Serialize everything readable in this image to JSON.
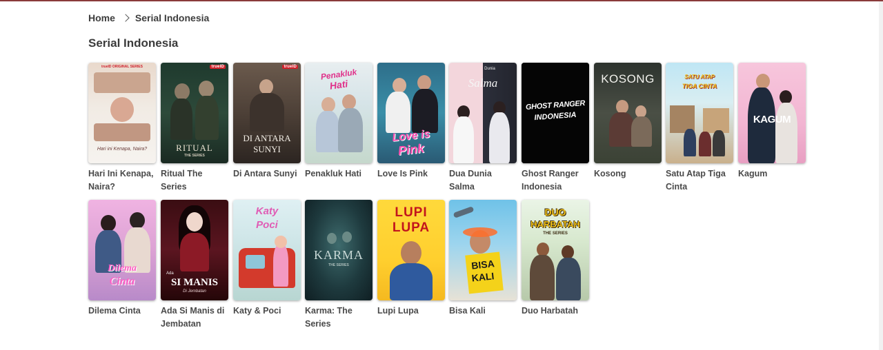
{
  "breadcrumb": {
    "home": "Home",
    "current": "Serial Indonesia"
  },
  "section": {
    "title": "Serial Indonesia"
  },
  "posters": {
    "naira": {
      "logo": "trueID",
      "tag": "trueID ORIGINAL SERIES",
      "text": "Hari ini Kenapa, Naira?"
    },
    "ritual": {
      "logo": "trueID",
      "text": "RITUAL",
      "sub": "THE SERIES"
    },
    "antara": {
      "logo": "trueID",
      "line1": "DI ANTARA",
      "line2": "SUNYI"
    },
    "penakluk": {
      "line1": "Penakluk",
      "line2": "Hati"
    },
    "love": {
      "line1": "Love is",
      "line2": "Pink"
    },
    "salma": {
      "small": "Dunia",
      "text": "Salma"
    },
    "ghost": {
      "line1": "GHOST RANGER",
      "line2": "INDONESIA"
    },
    "kosong": {
      "text": "KOSONG"
    },
    "satu": {
      "line1": "SATU ATAP",
      "line2": "TIGA CINTA"
    },
    "kagum": {
      "text": "KAGUM"
    },
    "dilema": {
      "line1": "Dilema",
      "line2": "Cinta"
    },
    "manis": {
      "small": "Ada",
      "text": "SI MANIS",
      "sub": "Di Jembatan"
    },
    "katy": {
      "line1": "Katy",
      "line2": "Poci"
    },
    "karma": {
      "text": "KARMA",
      "sub": "THE SERIES"
    },
    "lupi": {
      "line1": "LUPI",
      "line2": "LUPA"
    },
    "bisa": {
      "line1": "BISA",
      "line2": "KALI"
    },
    "duo": {
      "line1": "DUO",
      "line2": "HARBATAH",
      "sub": "THE SERIES"
    }
  },
  "titles": {
    "naira": "Hari Ini Kenapa, Naira?",
    "ritual": "Ritual The Series",
    "antara": "Di Antara Sunyi",
    "penakluk": "Penakluk Hati",
    "love": "Love Is Pink",
    "salma": "Dua Dunia Salma",
    "ghost": "Ghost Ranger Indonesia",
    "kosong": "Kosong",
    "satu": "Satu Atap Tiga Cinta",
    "kagum": "Kagum",
    "dilema": "Dilema Cinta",
    "manis": "Ada Si Manis di Jembatan",
    "katy": "Katy & Poci",
    "karma": "Karma: The Series",
    "lupi": "Lupi Lupa",
    "bisa": "Bisa Kali",
    "duo": "Duo Harbatah"
  }
}
